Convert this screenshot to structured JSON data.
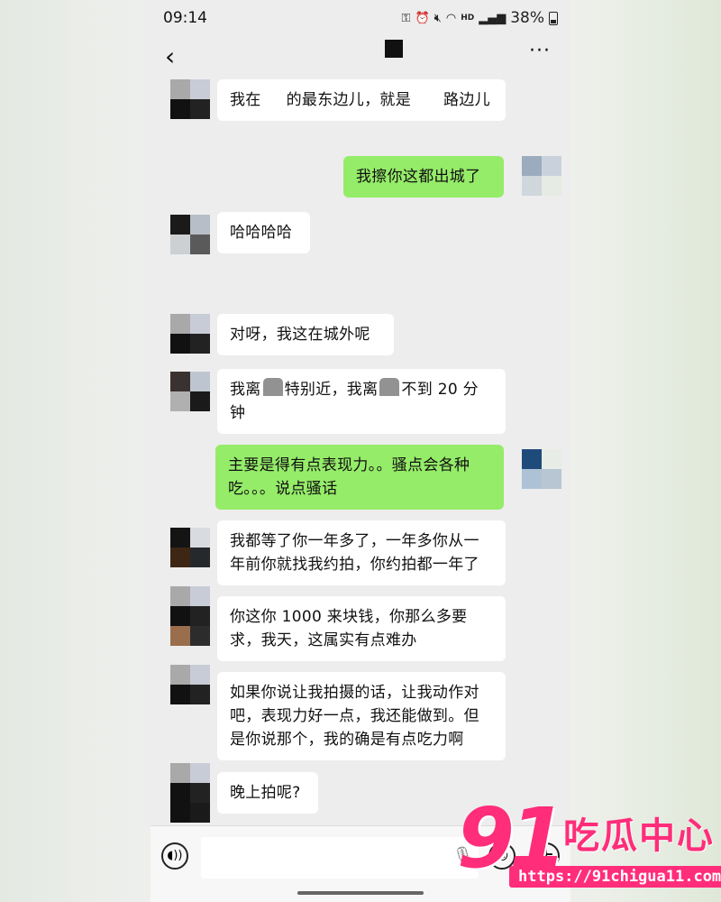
{
  "status_bar": {
    "time": "09:14",
    "network": "HD",
    "battery": "38%",
    "icons": [
      "key-icon",
      "alarm-icon",
      "mute-icon",
      "wifi-icon",
      "signal-icon",
      "battery-icon"
    ]
  },
  "header": {
    "back_icon": "‹",
    "more_icon": "···"
  },
  "messages": [
    {
      "side": "left",
      "text_parts": [
        "我在",
        "的最东边儿，就是",
        "路边儿"
      ]
    },
    {
      "side": "right",
      "text": "我擦你这都出城了"
    },
    {
      "side": "left",
      "text": "哈哈哈哈"
    },
    {
      "side": "left",
      "text": "对呀，我这在城外呢"
    },
    {
      "side": "left",
      "text_parts": [
        "我离",
        "特别近，我离",
        "不到 20 分钟"
      ]
    },
    {
      "side": "right",
      "text": "主要是得有点表现力。。骚点会各种吃。。。说点骚话"
    },
    {
      "side": "left",
      "text": "我都等了你一年多了，一年多你从一年前你就找我约拍，你约拍都一年了"
    },
    {
      "side": "left",
      "text": "你这你 1000 来块钱，你那么多要求，我天，这属实有点难办"
    },
    {
      "side": "left",
      "text": "如果你说让我拍摄的话，让我动作对吧，表现力好一点，我还能做到。但是你说那个，我的确是有点吃力啊"
    },
    {
      "side": "left",
      "text": "晚上拍呢?"
    }
  ],
  "input_bar": {
    "voice_icon": "voice-icon",
    "emoji_icon": "emoji-icon",
    "plus_icon": "plus-icon"
  },
  "watermark": {
    "number": "91",
    "name": "吃瓜中心",
    "url": "https://91chigua11.com"
  }
}
